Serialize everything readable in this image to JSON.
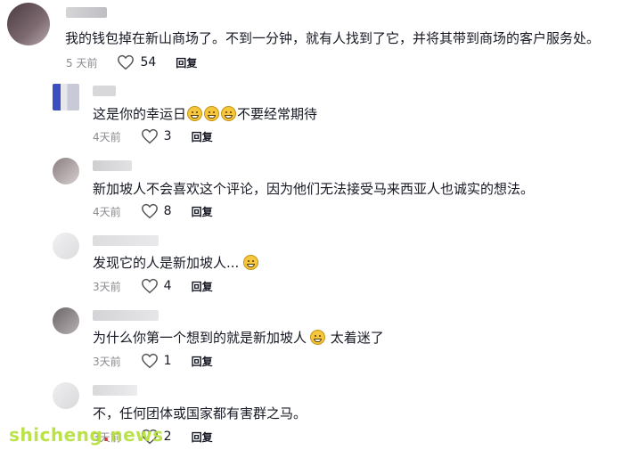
{
  "comments": [
    {
      "text": "我的钱包掉在新山商场了。不到一分钟，就有人找到了它，并将其带到商场的客户服务处。",
      "time": "5 天前",
      "likes": "54",
      "reply": "回复"
    },
    {
      "text_before": "这是你的幸运日",
      "emoji_count": 3,
      "text_after": "不要经常期待",
      "time": "4天前",
      "likes": "3",
      "reply": "回复"
    },
    {
      "text": "新加坡人不会喜欢这个评论，因为他们无法接受马来西亚人也诚实的想法。",
      "time": "4天前",
      "likes": "8",
      "reply": "回复"
    },
    {
      "text_before": "发现它的人是新加坡人...",
      "time": "3天前",
      "likes": "4",
      "reply": "回复"
    },
    {
      "text_before": "为什么你第一个想到的就是新加坡人",
      "text_after": " 太着迷了",
      "time": "3天前",
      "likes": "1",
      "reply": "回复"
    },
    {
      "text": "不，任何团体或国家都有害群之马。",
      "time": "3天前",
      "likes": "2",
      "reply": "回复"
    }
  ],
  "icons": {
    "like": "heart-outline-icon",
    "emoji": "grinning-face-emoji"
  },
  "watermark": {
    "part1": "shicheng",
    "dot": ".",
    "part2": "news"
  },
  "colors": {
    "text": "#161823",
    "meta": "#8a8b91",
    "watermark": "#b5e03a"
  }
}
